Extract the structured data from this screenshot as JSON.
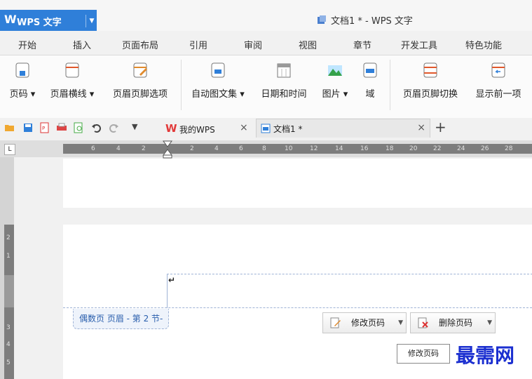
{
  "app": {
    "name": "WPS 文字",
    "logo_glyph": "W",
    "window_title": "文档1 * - WPS 文字",
    "accent": "#2f7fd9"
  },
  "menu_tabs": [
    "开始",
    "插入",
    "页面布局",
    "引用",
    "审阅",
    "视图",
    "章节",
    "开发工具",
    "特色功能"
  ],
  "ribbon": {
    "page_number": "页码 ▾",
    "header_line": "页眉横线 ▾",
    "header_footer_options": "页眉页脚选项",
    "auto_text": "自动图文集 ▾",
    "date_time": "日期和时间",
    "picture": "图片 ▾",
    "field": "域",
    "header_footer_switch": "页眉页脚切换",
    "show_previous": "显示前一项"
  },
  "doc_tabs": {
    "mywps": "我的WPS",
    "doc1": "文档1 *",
    "close": "×",
    "add": "+"
  },
  "ruler": {
    "corner": "L",
    "left_numbers": [
      "6",
      "4",
      "2"
    ],
    "right_numbers": [
      "2",
      "4",
      "6",
      "8",
      "10",
      "12",
      "14",
      "16",
      "18",
      "20",
      "22",
      "24",
      "26",
      "28"
    ],
    "vertical_numbers": [
      "2",
      "1",
      "1",
      "3",
      "4",
      "5"
    ]
  },
  "header_editor": {
    "cursor_mark": "↵",
    "tag": "偶数页 页眉 - 第 2 节-",
    "modify_page_number": "修改页码",
    "delete_page_number": "删除页码",
    "tooltip": "修改页码"
  },
  "watermark": "最需网"
}
